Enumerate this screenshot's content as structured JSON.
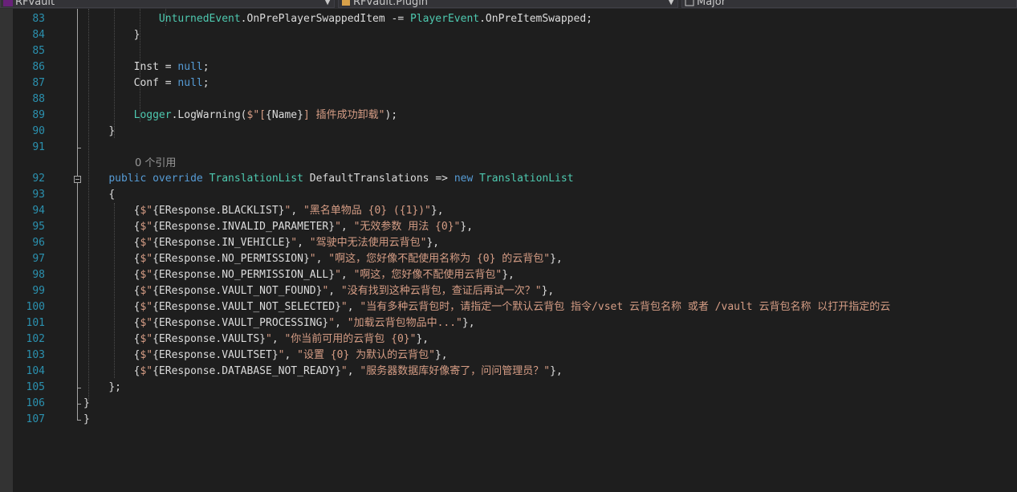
{
  "navbar": {
    "project": "RFvault",
    "type": "RFvault.Plugin",
    "member": "Major"
  },
  "codelens": "0 个引用",
  "lines": [
    {
      "n": "83",
      "indent": "            ",
      "tokens": [
        {
          "c": "ty",
          "t": "UnturnedEvent"
        },
        {
          "c": "tx",
          "t": ".OnPrePlayerSwappedItem -= "
        },
        {
          "c": "ty",
          "t": "PlayerEvent"
        },
        {
          "c": "tx",
          "t": ".OnPreItemSwapped;"
        }
      ]
    },
    {
      "n": "84",
      "indent": "        ",
      "tokens": [
        {
          "c": "tx",
          "t": "}"
        }
      ]
    },
    {
      "n": "85",
      "indent": "",
      "tokens": []
    },
    {
      "n": "86",
      "indent": "        ",
      "tokens": [
        {
          "c": "tx",
          "t": "Inst = "
        },
        {
          "c": "kw",
          "t": "null"
        },
        {
          "c": "tx",
          "t": ";"
        }
      ]
    },
    {
      "n": "87",
      "indent": "        ",
      "tokens": [
        {
          "c": "tx",
          "t": "Conf = "
        },
        {
          "c": "kw",
          "t": "null"
        },
        {
          "c": "tx",
          "t": ";"
        }
      ]
    },
    {
      "n": "88",
      "indent": "",
      "tokens": []
    },
    {
      "n": "89",
      "indent": "        ",
      "tokens": [
        {
          "c": "ty",
          "t": "Logger"
        },
        {
          "c": "tx",
          "t": ".LogWarning("
        },
        {
          "c": "str",
          "t": "$\"["
        },
        {
          "c": "tx",
          "t": "{Name}"
        },
        {
          "c": "str",
          "t": "] 插件成功卸载\""
        },
        {
          "c": "tx",
          "t": ");"
        }
      ]
    },
    {
      "n": "90",
      "indent": "    ",
      "tokens": [
        {
          "c": "tx",
          "t": "}"
        }
      ]
    },
    {
      "n": "91",
      "indent": "",
      "tokens": []
    },
    {
      "n": "92",
      "indent": "    ",
      "tokens": [
        {
          "c": "kw",
          "t": "public"
        },
        {
          "c": "tx",
          "t": " "
        },
        {
          "c": "kw",
          "t": "override"
        },
        {
          "c": "tx",
          "t": " "
        },
        {
          "c": "ty",
          "t": "TranslationList"
        },
        {
          "c": "tx",
          "t": " DefaultTranslations => "
        },
        {
          "c": "kw",
          "t": "new"
        },
        {
          "c": "tx",
          "t": " "
        },
        {
          "c": "ty",
          "t": "TranslationList"
        }
      ]
    },
    {
      "n": "93",
      "indent": "    ",
      "tokens": [
        {
          "c": "tx",
          "t": "{"
        }
      ]
    },
    {
      "n": "94",
      "indent": "        ",
      "tokens": [
        {
          "c": "tx",
          "t": "{"
        },
        {
          "c": "str",
          "t": "$\""
        },
        {
          "c": "tx",
          "t": "{EResponse.BLACKLIST}"
        },
        {
          "c": "str",
          "t": "\""
        },
        {
          "c": "tx",
          "t": ", "
        },
        {
          "c": "str",
          "t": "\"黑名单物品 {0} ({1})\""
        },
        {
          "c": "tx",
          "t": "},"
        }
      ]
    },
    {
      "n": "95",
      "indent": "        ",
      "tokens": [
        {
          "c": "tx",
          "t": "{"
        },
        {
          "c": "str",
          "t": "$\""
        },
        {
          "c": "tx",
          "t": "{EResponse.INVALID_PARAMETER}"
        },
        {
          "c": "str",
          "t": "\""
        },
        {
          "c": "tx",
          "t": ", "
        },
        {
          "c": "str",
          "t": "\"无效参数 用法 {0}\""
        },
        {
          "c": "tx",
          "t": "},"
        }
      ]
    },
    {
      "n": "96",
      "indent": "        ",
      "tokens": [
        {
          "c": "tx",
          "t": "{"
        },
        {
          "c": "str",
          "t": "$\""
        },
        {
          "c": "tx",
          "t": "{EResponse.IN_VEHICLE}"
        },
        {
          "c": "str",
          "t": "\""
        },
        {
          "c": "tx",
          "t": ", "
        },
        {
          "c": "str",
          "t": "\"驾驶中无法使用云背包\""
        },
        {
          "c": "tx",
          "t": "},"
        }
      ]
    },
    {
      "n": "97",
      "indent": "        ",
      "tokens": [
        {
          "c": "tx",
          "t": "{"
        },
        {
          "c": "str",
          "t": "$\""
        },
        {
          "c": "tx",
          "t": "{EResponse.NO_PERMISSION}"
        },
        {
          "c": "str",
          "t": "\""
        },
        {
          "c": "tx",
          "t": ", "
        },
        {
          "c": "str",
          "t": "\"啊这，您好像不配使用名称为 {0} 的云背包\""
        },
        {
          "c": "tx",
          "t": "},"
        }
      ]
    },
    {
      "n": "98",
      "indent": "        ",
      "tokens": [
        {
          "c": "tx",
          "t": "{"
        },
        {
          "c": "str",
          "t": "$\""
        },
        {
          "c": "tx",
          "t": "{EResponse.NO_PERMISSION_ALL}"
        },
        {
          "c": "str",
          "t": "\""
        },
        {
          "c": "tx",
          "t": ", "
        },
        {
          "c": "str",
          "t": "\"啊这，您好像不配使用云背包\""
        },
        {
          "c": "tx",
          "t": "},"
        }
      ]
    },
    {
      "n": "99",
      "indent": "        ",
      "tokens": [
        {
          "c": "tx",
          "t": "{"
        },
        {
          "c": "str",
          "t": "$\""
        },
        {
          "c": "tx",
          "t": "{EResponse.VAULT_NOT_FOUND}"
        },
        {
          "c": "str",
          "t": "\""
        },
        {
          "c": "tx",
          "t": ", "
        },
        {
          "c": "str",
          "t": "\"没有找到这种云背包，查证后再试一次？\""
        },
        {
          "c": "tx",
          "t": "},"
        }
      ]
    },
    {
      "n": "100",
      "indent": "        ",
      "tokens": [
        {
          "c": "tx",
          "t": "{"
        },
        {
          "c": "str",
          "t": "$\""
        },
        {
          "c": "tx",
          "t": "{EResponse.VAULT_NOT_SELECTED}"
        },
        {
          "c": "str",
          "t": "\""
        },
        {
          "c": "tx",
          "t": ", "
        },
        {
          "c": "str",
          "t": "\"当有多种云背包时，请指定一个默认云背包 指令/vset 云背包名称 或者 /vault 云背包名称 以打开指定的云"
        }
      ]
    },
    {
      "n": "101",
      "indent": "        ",
      "tokens": [
        {
          "c": "tx",
          "t": "{"
        },
        {
          "c": "str",
          "t": "$\""
        },
        {
          "c": "tx",
          "t": "{EResponse.VAULT_PROCESSING}"
        },
        {
          "c": "str",
          "t": "\""
        },
        {
          "c": "tx",
          "t": ", "
        },
        {
          "c": "str",
          "t": "\"加载云背包物品中...\""
        },
        {
          "c": "tx",
          "t": "},"
        }
      ]
    },
    {
      "n": "102",
      "indent": "        ",
      "tokens": [
        {
          "c": "tx",
          "t": "{"
        },
        {
          "c": "str",
          "t": "$\""
        },
        {
          "c": "tx",
          "t": "{EResponse.VAULTS}"
        },
        {
          "c": "str",
          "t": "\""
        },
        {
          "c": "tx",
          "t": ", "
        },
        {
          "c": "str",
          "t": "\"你当前可用的云背包 {0}\""
        },
        {
          "c": "tx",
          "t": "},"
        }
      ]
    },
    {
      "n": "103",
      "indent": "        ",
      "tokens": [
        {
          "c": "tx",
          "t": "{"
        },
        {
          "c": "str",
          "t": "$\""
        },
        {
          "c": "tx",
          "t": "{EResponse.VAULTSET}"
        },
        {
          "c": "str",
          "t": "\""
        },
        {
          "c": "tx",
          "t": ", "
        },
        {
          "c": "str",
          "t": "\"设置 {0} 为默认的云背包\""
        },
        {
          "c": "tx",
          "t": "},"
        }
      ]
    },
    {
      "n": "104",
      "indent": "        ",
      "tokens": [
        {
          "c": "tx",
          "t": "{"
        },
        {
          "c": "str",
          "t": "$\""
        },
        {
          "c": "tx",
          "t": "{EResponse.DATABASE_NOT_READY}"
        },
        {
          "c": "str",
          "t": "\""
        },
        {
          "c": "tx",
          "t": ", "
        },
        {
          "c": "str",
          "t": "\"服务器数据库好像寄了，问问管理员？\""
        },
        {
          "c": "tx",
          "t": "},"
        }
      ]
    },
    {
      "n": "105",
      "indent": "    ",
      "tokens": [
        {
          "c": "tx",
          "t": "};"
        }
      ]
    },
    {
      "n": "106",
      "indent": "",
      "tokens": [
        {
          "c": "tx",
          "t": "}"
        }
      ]
    },
    {
      "n": "107",
      "indent": "",
      "tokens": [
        {
          "c": "tx",
          "t": "}"
        }
      ]
    }
  ],
  "colors": {
    "background": "#1e1e1e",
    "line_number": "#2b91af",
    "keyword": "#569cd6",
    "type": "#4ec9b0",
    "string": "#d69d85",
    "plain": "#dcdcdc"
  }
}
